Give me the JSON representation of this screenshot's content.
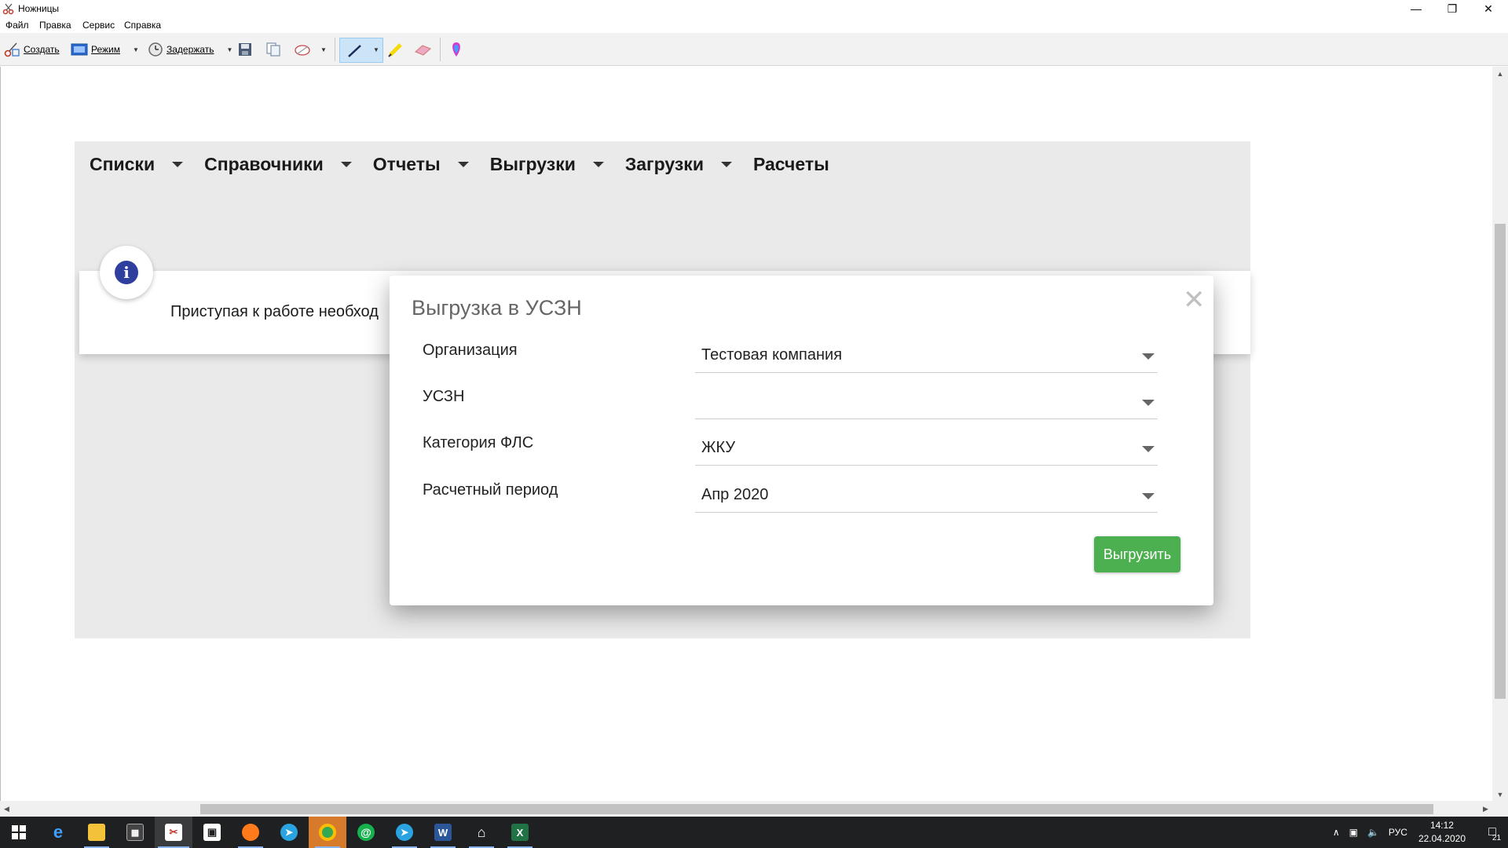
{
  "window": {
    "title": "Ножницы",
    "menu": [
      "Файл",
      "Правка",
      "Сервис",
      "Справка"
    ],
    "toolbar": {
      "create_label": "Создать",
      "mode_label": "Режим",
      "delay_label": "Задержать"
    }
  },
  "page": {
    "nav": [
      "Списки",
      "Справочники",
      "Отчеты",
      "Выгрузки",
      "Загрузки",
      "Расчеты"
    ],
    "info_text": "Приступая к работе необход"
  },
  "modal": {
    "title": "Выгрузка в УСЗН",
    "fields": [
      {
        "label": "Организация",
        "value": "Тестовая компания"
      },
      {
        "label": "УСЗН",
        "value": ""
      },
      {
        "label": "Категория ФЛС",
        "value": "ЖКУ"
      },
      {
        "label": "Расчетный период",
        "value": "Апр 2020"
      }
    ],
    "submit_label": "Выгрузить"
  },
  "taskbar": {
    "language": "РУС",
    "time": "14:12",
    "date": "22.04.2020",
    "notifications": "21"
  }
}
